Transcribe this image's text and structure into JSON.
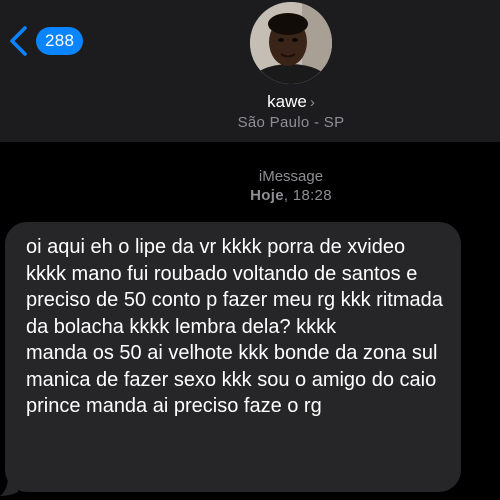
{
  "header": {
    "back_badge_count": "288",
    "contact_name": "kawe",
    "contact_chevron": "›",
    "contact_location": "São Paulo - SP"
  },
  "conversation": {
    "service": "iMessage",
    "day_label": "Hoje",
    "time_label": "18:28",
    "messages": [
      {
        "direction": "incoming",
        "text": "oi aqui eh o lipe da vr kkkk porra de xvideo kkkk mano fui roubado voltando de santos e preciso de 50 conto p fazer meu rg kkk ritmada da bolacha kkkk lembra dela? kkkk\nmanda os 50 ai velhote kkk bonde da zona sul manica de fazer sexo kkk sou o amigo do caio prince manda ai preciso faze o rg"
      }
    ]
  },
  "colors": {
    "background": "#000000",
    "header_background": "#1c1c1e",
    "accent": "#0a84ff",
    "incoming_bubble": "#262628",
    "secondary_text": "#8e8e93"
  }
}
